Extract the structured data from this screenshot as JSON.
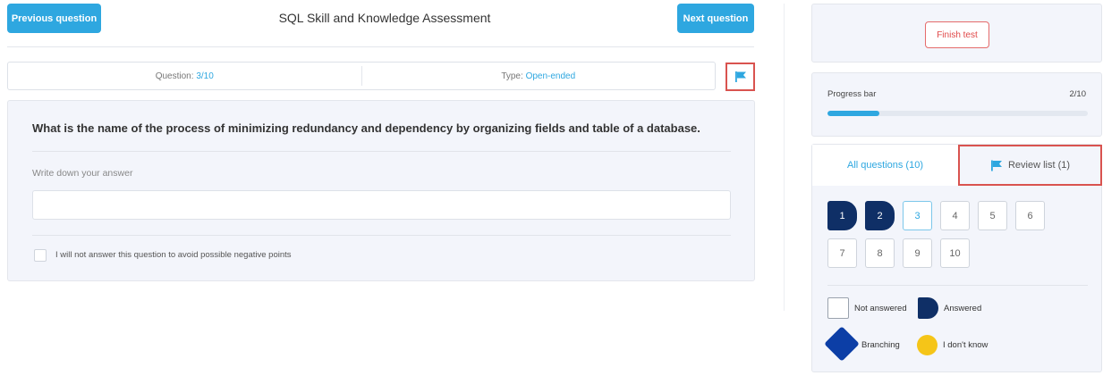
{
  "header": {
    "title": "SQL Skill and Knowledge Assessment",
    "prev_label": "Previous question",
    "next_label": "Next question"
  },
  "info": {
    "question_label": "Question:",
    "question_value": "3/10",
    "type_label": "Type:",
    "type_value": "Open-ended"
  },
  "question": {
    "text": "What is the name of the process of minimizing redundancy and dependency by organizing fields and table of a database.",
    "answer_label": "Write down your answer",
    "answer_value": "",
    "skip_label": "I will not answer this question to avoid possible negative points",
    "skip_checked": false
  },
  "sidebar": {
    "finish_label": "Finish test",
    "progress_label": "Progress bar",
    "progress_count": "2/10",
    "progress_fraction": 0.2,
    "tabs": {
      "all_label": "All questions (10)",
      "review_label": "Review list (1)"
    },
    "questions": [
      {
        "num": "1",
        "state": "answered"
      },
      {
        "num": "2",
        "state": "answered"
      },
      {
        "num": "3",
        "state": "current"
      },
      {
        "num": "4",
        "state": "not-answered"
      },
      {
        "num": "5",
        "state": "not-answered"
      },
      {
        "num": "6",
        "state": "not-answered"
      },
      {
        "num": "7",
        "state": "not-answered"
      },
      {
        "num": "8",
        "state": "not-answered"
      },
      {
        "num": "9",
        "state": "not-answered"
      },
      {
        "num": "10",
        "state": "not-answered"
      }
    ],
    "legend": {
      "not_answered": "Not answered",
      "answered": "Answered",
      "branching": "Branching",
      "dont_know": "I don't know"
    }
  },
  "colors": {
    "accent": "#2ea7e0",
    "answered": "#0f2f66",
    "branching": "#0c3ea6",
    "dont_know": "#f5c518",
    "highlight": "#d9534f"
  },
  "icons": {
    "flag": "flag-icon",
    "review_flag": "flag-icon"
  }
}
